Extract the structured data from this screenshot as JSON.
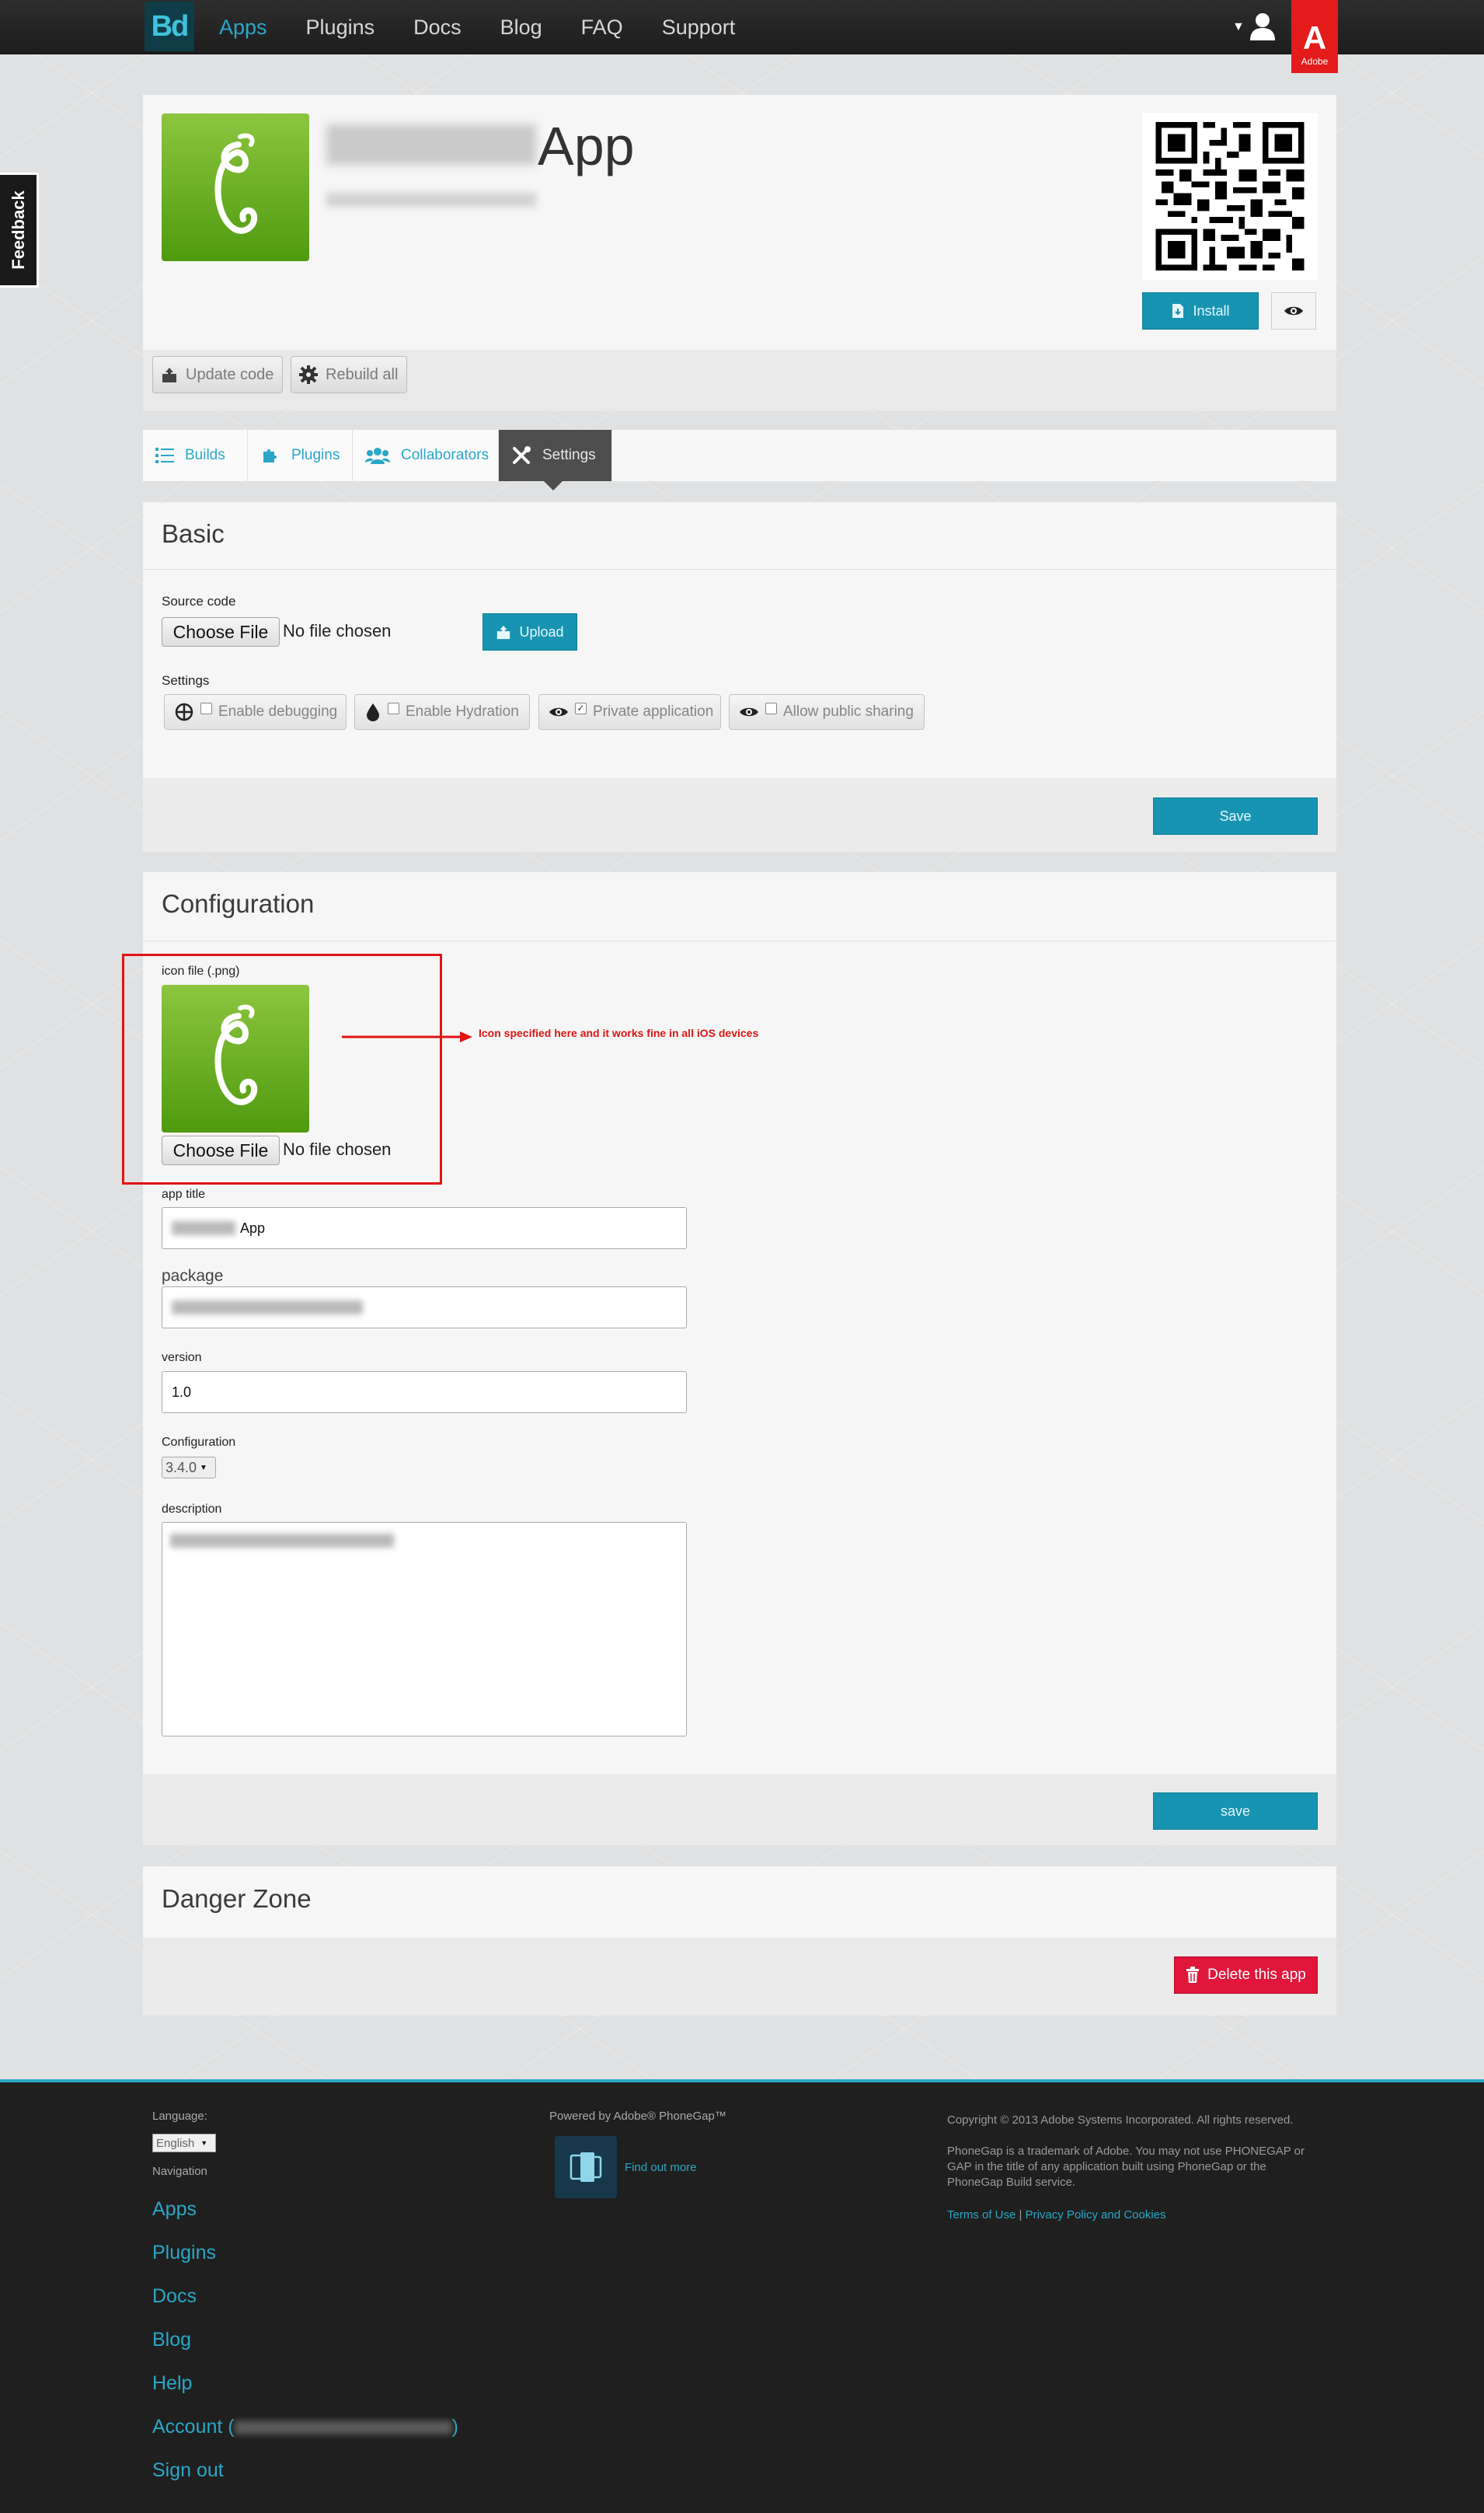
{
  "nav": {
    "logo": "Bd",
    "items": [
      {
        "label": "Apps",
        "active": true
      },
      {
        "label": "Plugins",
        "active": false
      },
      {
        "label": "Docs",
        "active": false
      },
      {
        "label": "Blog",
        "active": false
      },
      {
        "label": "FAQ",
        "active": false
      },
      {
        "label": "Support",
        "active": false
      }
    ],
    "adobe_word": "Adobe",
    "adobe_mark": "A"
  },
  "feedback_label": "Feedback",
  "header": {
    "app_name": "App",
    "install_label": "Install",
    "update_code_label": "Update code",
    "rebuild_all_label": "Rebuild all"
  },
  "tabs": [
    {
      "label": "Builds",
      "icon": "list-icon",
      "active": false
    },
    {
      "label": "Plugins",
      "icon": "puzzle-icon",
      "active": false
    },
    {
      "label": "Collaborators",
      "icon": "people-icon",
      "active": false
    },
    {
      "label": "Settings",
      "icon": "wrench-icon",
      "active": true
    }
  ],
  "basic": {
    "title": "Basic",
    "source_code_label": "Source code",
    "choose_file_label": "Choose File",
    "no_file_label": "No file chosen",
    "upload_label": "Upload",
    "settings_label": "Settings",
    "settings": [
      {
        "label": "Enable debugging",
        "icon": "crosshair-icon",
        "checked": false
      },
      {
        "label": "Enable Hydration",
        "icon": "drop-icon",
        "checked": false
      },
      {
        "label": "Private application",
        "icon": "eye-icon",
        "checked": true
      },
      {
        "label": "Allow public sharing",
        "icon": "eye-icon",
        "checked": false
      }
    ],
    "save_label": "Save"
  },
  "configuration": {
    "title": "Configuration",
    "icon_file_label": "icon file (.png)",
    "choose_file_label": "Choose File",
    "no_file_label": "No file chosen",
    "annotation": "Icon specified here and it works fine in all iOS devices",
    "app_title_label": "app title",
    "app_title_value": "App",
    "package_label": "package",
    "version_label": "version",
    "version_value": "1.0",
    "config_label": "Configuration",
    "config_value": "3.4.0",
    "description_label": "description",
    "save_label": "save"
  },
  "danger": {
    "title": "Danger Zone",
    "delete_label": "Delete this app"
  },
  "footer": {
    "language_label": "Language:",
    "language_value": "English",
    "navigation_label": "Navigation",
    "links": [
      "Apps",
      "Plugins",
      "Docs",
      "Blog",
      "Help",
      "Account (",
      "Sign out"
    ],
    "account_close": ")",
    "powered_by": "Powered by Adobe® PhoneGap™",
    "find_out_more": "Find out more",
    "copyright": "Copyright © 2013 Adobe Systems Incorporated. All rights reserved.",
    "trademark": "PhoneGap is a trademark of Adobe. You may not use PHONEGAP or GAP in the title of any application built using PhoneGap or the PhoneGap Build service.",
    "terms": "Terms of Use",
    "separator": "|",
    "privacy": "Privacy Policy and Cookies"
  },
  "colors": {
    "accent": "#2aa7c7",
    "teal_button": "#1794b1",
    "danger": "#e0163a",
    "adobe_red": "#e41b1b",
    "annotation_red": "#e01414"
  }
}
